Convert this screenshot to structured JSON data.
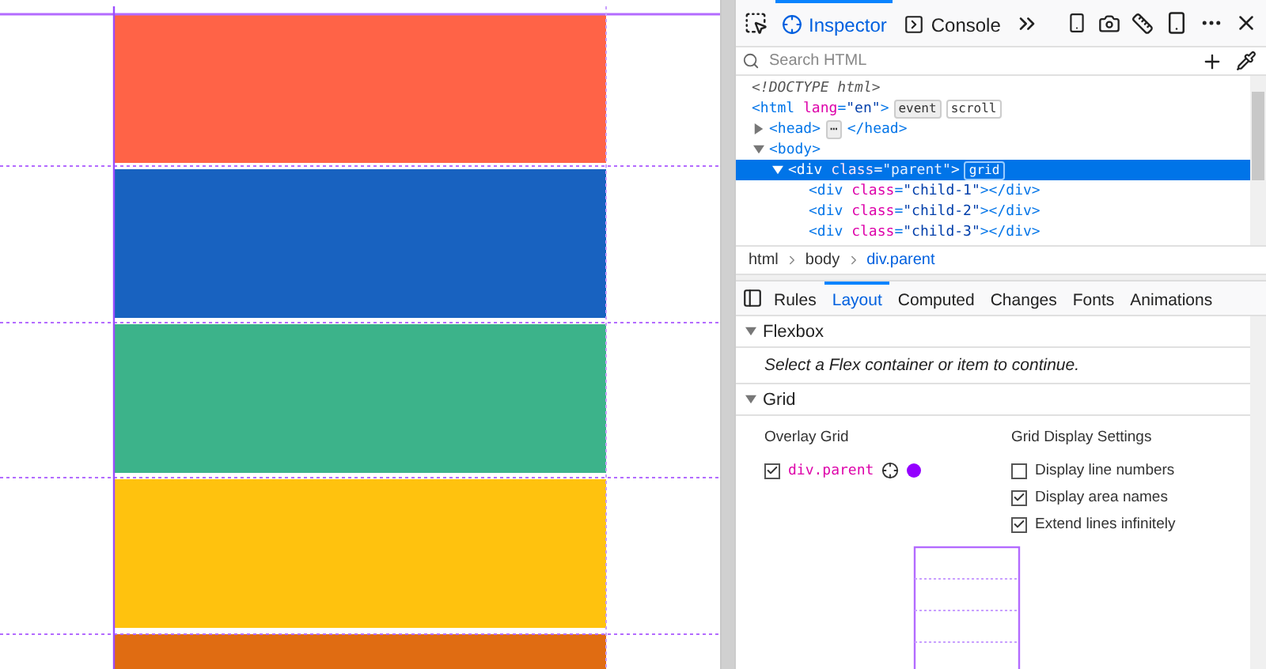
{
  "page": {
    "blocks": [
      {
        "color": "#ff6347"
      },
      {
        "color": "#1862c0"
      },
      {
        "color": "#3cb38a"
      },
      {
        "color": "#ffc20e"
      },
      {
        "color": "#e06c12"
      }
    ]
  },
  "toolbar": {
    "tabs": [
      {
        "label": "Inspector",
        "kind": "inspector",
        "selected": true
      },
      {
        "label": "Console",
        "kind": "console",
        "selected": false
      }
    ]
  },
  "search": {
    "placeholder": "Search HTML"
  },
  "tree": [
    {
      "parts": [
        {
          "kind": "doctype",
          "text": "<!DOCTYPE html>"
        }
      ],
      "selected": false
    },
    {
      "parts": [
        {
          "kind": "tag",
          "text": "<html "
        },
        {
          "kind": "attr",
          "text": "lang"
        },
        {
          "kind": "tag",
          "text": "="
        },
        {
          "kind": "value",
          "text": "\"en\""
        },
        {
          "kind": "tag",
          "text": ">"
        }
      ],
      "selected": false,
      "badges": [
        {
          "label": "event",
          "kind": "plain"
        },
        {
          "label": "scroll",
          "kind": "outline"
        }
      ],
      "children": [
        {
          "parts": [
            {
              "kind": "tag",
              "text": "<head>"
            }
          ],
          "collapsed_badge": "⋯",
          "tail": "</head>",
          "expanded": false,
          "selected": false
        },
        {
          "parts": [
            {
              "kind": "tag",
              "text": "<body>"
            }
          ],
          "expanded": true,
          "selected": false,
          "children": [
            {
              "parts": [
                {
                  "kind": "tag",
                  "text": "<div "
                },
                {
                  "kind": "attr",
                  "text": "class"
                },
                {
                  "kind": "tag",
                  "text": "="
                },
                {
                  "kind": "value",
                  "text": "\"parent\""
                },
                {
                  "kind": "tag",
                  "text": ">"
                }
              ],
              "badges": [
                {
                  "label": "grid",
                  "kind": "grid"
                }
              ],
              "expanded": true,
              "selected": true,
              "children": [
                {
                  "parts": [
                    {
                      "kind": "tag",
                      "text": "<div "
                    },
                    {
                      "kind": "attr",
                      "text": "class"
                    },
                    {
                      "kind": "tag",
                      "text": "="
                    },
                    {
                      "kind": "value",
                      "text": "\"child-1\""
                    },
                    {
                      "kind": "tag",
                      "text": "></div>"
                    }
                  ],
                  "selected": false
                },
                {
                  "parts": [
                    {
                      "kind": "tag",
                      "text": "<div "
                    },
                    {
                      "kind": "attr",
                      "text": "class"
                    },
                    {
                      "kind": "tag",
                      "text": "="
                    },
                    {
                      "kind": "value",
                      "text": "\"child-2\""
                    },
                    {
                      "kind": "tag",
                      "text": "></div>"
                    }
                  ],
                  "selected": false
                },
                {
                  "parts": [
                    {
                      "kind": "tag",
                      "text": "<div "
                    },
                    {
                      "kind": "attr",
                      "text": "class"
                    },
                    {
                      "kind": "tag",
                      "text": "="
                    },
                    {
                      "kind": "value",
                      "text": "\"child-3\""
                    },
                    {
                      "kind": "tag",
                      "text": "></div>"
                    }
                  ],
                  "selected": false
                }
              ]
            }
          ]
        }
      ]
    }
  ],
  "breadcrumbs": [
    {
      "label": "html",
      "selected": false
    },
    {
      "label": "body",
      "selected": false
    },
    {
      "label": "div.parent",
      "selected": true
    }
  ],
  "sidebar_tabs": [
    {
      "label": "Rules",
      "selected": false
    },
    {
      "label": "Layout",
      "selected": true
    },
    {
      "label": "Computed",
      "selected": false
    },
    {
      "label": "Changes",
      "selected": false
    },
    {
      "label": "Fonts",
      "selected": false
    },
    {
      "label": "Animations",
      "selected": false
    }
  ],
  "flexbox": {
    "title": "Flexbox",
    "expanded": true,
    "message": "Select a Flex container or item to continue."
  },
  "grid": {
    "title": "Grid",
    "expanded": true,
    "overlay_title": "Overlay Grid",
    "overlays": [
      {
        "label": "div.parent",
        "checked": true,
        "color": "#9400ff"
      }
    ],
    "settings_title": "Grid Display Settings",
    "settings": [
      {
        "label": "Display line numbers",
        "checked": false
      },
      {
        "label": "Display area names",
        "checked": true
      },
      {
        "label": "Extend lines infinitely",
        "checked": true
      }
    ]
  }
}
